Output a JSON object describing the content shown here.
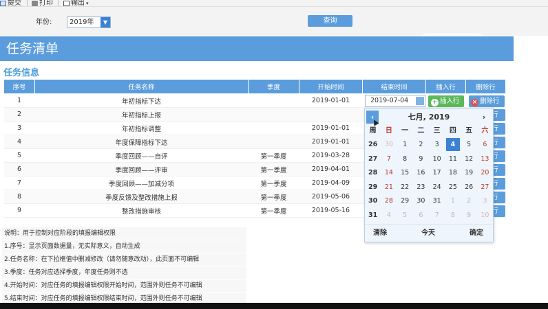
{
  "toolbar": {
    "submit": "提交",
    "print": "打印",
    "export": "输出"
  },
  "filter": {
    "year_label": "年份:",
    "year_value": "2019年",
    "query_label": "查询"
  },
  "banner_title": "任务清单",
  "section_title": "任务信息",
  "table": {
    "headers": [
      "序号",
      "任务名称",
      "季度",
      "开始时间",
      "结束时间",
      "插入行",
      "删除行"
    ],
    "rows": [
      {
        "no": "1",
        "name": "年初指标下达",
        "season": "",
        "start": "2019-01-01",
        "end": "2019-07-04"
      },
      {
        "no": "2",
        "name": "年初指标上报",
        "season": "",
        "start": "",
        "end": ""
      },
      {
        "no": "3",
        "name": "年初指标调整",
        "season": "",
        "start": "2019-01-01",
        "end": ""
      },
      {
        "no": "4",
        "name": "年度保障指标下达",
        "season": "",
        "start": "2019-01-01",
        "end": ""
      },
      {
        "no": "5",
        "name": "季度回顾——自评",
        "season": "第一季度",
        "start": "2019-03-28",
        "end": ""
      },
      {
        "no": "6",
        "name": "季度回顾——评审",
        "season": "第一季度",
        "start": "2019-04-01",
        "end": ""
      },
      {
        "no": "7",
        "name": "季度回顾——加减分项",
        "season": "第一季度",
        "start": "2019-04-09",
        "end": ""
      },
      {
        "no": "8",
        "name": "季度反馈及整改措施上报",
        "season": "第一季度",
        "start": "2019-05-06",
        "end": ""
      },
      {
        "no": "9",
        "name": "整改措施审核",
        "season": "第一季度",
        "start": "2019-05-16",
        "end": ""
      }
    ],
    "insert_label": "插入行",
    "delete_label": "删除行",
    "delete_stub": "行"
  },
  "calendar": {
    "title": "七月, 2019",
    "prev": "‹",
    "next": "›",
    "weekdays": [
      "周",
      "日",
      "一",
      "二",
      "三",
      "四",
      "五",
      "六"
    ],
    "weeks": [
      [
        "26",
        "30",
        "1",
        "2",
        "3",
        "4",
        "5",
        "6"
      ],
      [
        "27",
        "7",
        "8",
        "9",
        "10",
        "11",
        "12",
        "13"
      ],
      [
        "28",
        "14",
        "15",
        "16",
        "17",
        "18",
        "19",
        "20"
      ],
      [
        "29",
        "21",
        "22",
        "23",
        "24",
        "25",
        "26",
        "27"
      ],
      [
        "30",
        "28",
        "29",
        "30",
        "31",
        "1",
        "2",
        "3"
      ],
      [
        "31",
        "4",
        "5",
        "6",
        "7",
        "8",
        "9",
        "10"
      ]
    ],
    "today": "4",
    "clear": "清除",
    "today_label": "今天",
    "confirm": "确定",
    "accent": "#3b82d6"
  },
  "notes": [
    "说明：用于控制对应阶段的填报编辑权限",
    "1.序号：显示页面数据量，无实际意义，自动生成",
    "2.任务名称：在下拉框值中删减修改（请勿随意改动），此页面不可编辑",
    "3.季度：任务对应选择季度，年度任务则不选",
    "4.开始时间：对应任务的填报编辑权限开始时间，范围外则任务不可编辑",
    "5.结束时间：对应任务的填报编辑权限结束时间，范围外则任务不可编辑"
  ]
}
